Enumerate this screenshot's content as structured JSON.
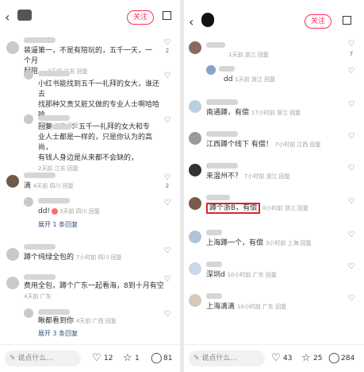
{
  "left": {
    "follow_label": "关注",
    "comments": [
      {
        "text_l1": "装逼第一，不是有陪玩的，五千一天，一个月",
        "text_l2": "起陪，",
        "meta": "2天前 江苏 回复",
        "likes": "2"
      },
      {
        "reply_l1": "小红书能找到五千一礼拜的女大，谁还去",
        "reply_l2": "找那种又贵又脏又做的专业人士啊哈哈哈",
        "meta": "2天前 江苏 回复"
      },
      {
        "reply_l1": "回复",
        "reply_l1b": "：五千一礼拜的女大和专",
        "reply_l2": "业人士都是一样的，只是你认为的高尚，",
        "reply_l3": "有钱人身边是从来都不会缺的，",
        "meta": "2天前 江苏 回复"
      },
      {
        "text_l1": "滴",
        "meta": "4天前 四川 回复",
        "likes": "2"
      },
      {
        "reply_text": "dd!",
        "meta": "3天前 四川 回复",
        "expand": "展开 1 条回复"
      },
      {
        "text_l1": "蹲个纯绿全包的",
        "meta": "7小时前 四川 回复"
      },
      {
        "text_l1": "费用全包，蹲个广东一起看海，8到十月有空",
        "meta": "4天前 广东"
      },
      {
        "reply_text": "瞅都看到你",
        "meta": "4天前 广西 回复",
        "expand": "展开 3 条回复"
      }
    ],
    "bottom": {
      "input_placeholder": "说点什么...",
      "likes": "12",
      "stars": "1",
      "comments": "81"
    }
  },
  "right": {
    "follow_label": "关注",
    "comments": [
      {
        "meta_top": "1天前 浙江 回复",
        "likes": "7"
      },
      {
        "reply_text": "dd",
        "meta": "1天前 浙江 回复"
      },
      {
        "text": "南通蹲，有偿",
        "meta": "17小时前 浙江 回复"
      },
      {
        "text": "江西蹲个线下 有偿！",
        "meta": "7小时前 江西 回复"
      },
      {
        "text": "来温州不？",
        "meta": "7小时前 浙江 回复"
      },
      {
        "text": "蹲个浙B，有偿",
        "meta": "0小时前 浙江 回复"
      },
      {
        "text": "上海蹲一个，有偿",
        "meta": "3小时前 上海 回复"
      },
      {
        "text": "深圳d",
        "meta": "10小时前 广东 回复"
      },
      {
        "text": "上海滴滴",
        "meta": "10小时前 广东 回复"
      }
    ],
    "bottom": {
      "input_placeholder": "说点什么...",
      "likes": "43",
      "stars": "25",
      "comments": "284"
    }
  }
}
